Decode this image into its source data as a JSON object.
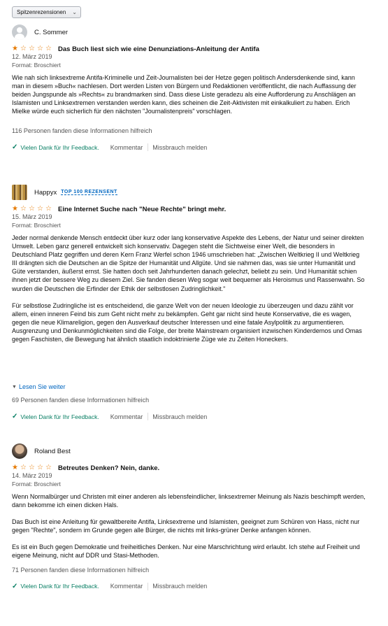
{
  "sort": {
    "label": "Spitzenrezensionen"
  },
  "colors": {
    "star": "#e67a00",
    "link": "#0066c0",
    "success": "#067d62"
  },
  "reviews": [
    {
      "author": "C. Sommer",
      "badge": "",
      "rating": 1,
      "rating_max": 5,
      "title": "Das Buch liest sich wie eine Denunziations-Anleitung der Antifa",
      "date": "12. März 2019",
      "format": "Format: Broschiert",
      "paragraphs": [
        "Wie nah sich linksextreme Antifa-Kriminelle und Zeit-Journalisten bei der Hetze gegen politisch Andersdenkende sind, kann man in diesem »Buch« nachlesen. Dort werden Listen von Bürgern und Redaktionen veröffentlicht, die nach Auffassung der beiden Jungspunde als »Rechts« zu brandmarken sind. Dass diese Liste geradezu als eine Aufforderung zu Anschlägen an Islamisten und Linksextremen verstanden werden kann, dies scheinen die Zeit-Aktivisten mit einkalkuliert zu haben. Erich Mielke würde euch sicherlich für den nächsten \"Journalistenpreis\" vorschlagen."
      ],
      "read_more": "",
      "helpful": "116 Personen fanden diese Informationen hilfreich",
      "thanks": "Vielen Dank für Ihr Feedback.",
      "comment": "Kommentar",
      "report": "Missbrauch melden"
    },
    {
      "author": "Happyx",
      "badge": "TOP 100 REZENSENT",
      "rating": 1,
      "rating_max": 5,
      "title": "Eine Internet Suche nach \"Neue Rechte\" bringt mehr.",
      "date": "15. März 2019",
      "format": "Format: Broschiert",
      "paragraphs": [
        "Jeder normal denkende Mensch entdeckt über kurz oder lang konservative Aspekte des Lebens, der Natur und seiner direkten Umwelt. Leben ganz generell entwickelt sich konservativ. Dagegen steht die Sichtweise einer Welt, die besonders in Deutschland Platz gegriffen und deren Kern Franz Werfel schon 1946 umschrieben hat: „Zwischen Weltkrieg II und Weltkrieg III drängten sich die Deutschen an die Spitze der Humanität und Allgüte. Und sie nahmen das, was sie unter Humanität und Güte verstanden, äußerst ernst. Sie hatten doch seit Jahrhunderten danach gelechzt, beliebt zu sein. Und Humanität schien ihnen jetzt der bessere Weg zu diesem Ziel. Sie fanden diesen Weg sogar weit bequemer als Heroismus und Rassenwahn. So wurden die Deutschen die Erfinder der Ethik der selbstlosen Zudringlichkeit.\"",
        "Für selbstlose Zudringliche ist es entscheidend, die ganze Welt von der neuen Ideologie zu überzeugen und dazu zählt vor allem, einen inneren Feind bis zum Geht nicht mehr zu bekämpfen. Geht gar nicht sind heute Konservative, die es wagen, gegen die neue Klimareligion, gegen den Ausverkauf deutscher Interessen und eine fatale Asylpolitik zu argumentieren. Ausgrenzung und Denkunmöglichkeiten sind die Folge, der breite Mainstream organisiert inzwischen Kinderdemos und Omas gegen Faschisten, die Bewegung hat ähnlich staatlich indoktrinierte Züge wie zu Zeiten Honeckers."
      ],
      "read_more": "Lesen Sie weiter",
      "helpful": "69 Personen fanden diese Informationen hilfreich",
      "thanks": "Vielen Dank für Ihr Feedback.",
      "comment": "Kommentar",
      "report": "Missbrauch melden"
    },
    {
      "author": "Roland Best",
      "badge": "",
      "rating": 1,
      "rating_max": 5,
      "title": "Betreutes Denken? Nein, danke.",
      "date": "14. März 2019",
      "format": "Format: Broschiert",
      "paragraphs": [
        "Wenn Normalbürger und Christen mit einer anderen als lebensfeindlicher, linksextremer Meinung als Nazis beschimpft werden, dann bekomme ich einen dicken Hals.",
        "Das Buch ist eine Anleitung für gewaltbereite Antifa, Linksextreme und Islamisten, geeignet zum Schüren von Hass, nicht nur gegen \"Rechte\", sondern im Grunde gegen alle Bürger, die nichts mit links-grüner Denke anfangen können.",
        "Es ist ein Buch gegen Demokratie und freiheitliches Denken. Nur eine Marschrichtung wird erlaubt. Ich stehe auf Freiheit und eigene Meinung, nicht auf DDR und Stasi-Methoden."
      ],
      "read_more": "",
      "helpful": "71 Personen fanden diese Informationen hilfreich",
      "thanks": "Vielen Dank für Ihr Feedback.",
      "comment": "Kommentar",
      "report": "Missbrauch melden"
    }
  ]
}
